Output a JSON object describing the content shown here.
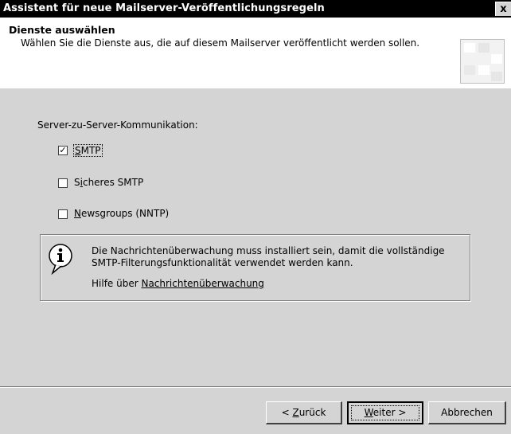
{
  "window": {
    "title": "Assistent für neue Mailserver-Veröffentlichungsregeln",
    "close": "x"
  },
  "header": {
    "title": "Dienste auswählen",
    "subtitle": "Wählen Sie die Dienste aus, die auf diesem Mailserver veröffentlicht werden sollen."
  },
  "section": {
    "label": "Server-zu-Server-Kommunikation:"
  },
  "options": [
    {
      "label": "SMTP",
      "checked": true
    },
    {
      "label": "Sicheres SMTP",
      "checked": false
    },
    {
      "label": "Newsgroups (NNTP)",
      "checked": false
    }
  ],
  "info": {
    "text": "Die Nachrichtenüberwachung muss installiert sein, damit die vollständige SMTP-Filterungsfunktionalität verwendet werden kann.",
    "help_prefix": "Hilfe über ",
    "help_link": "Nachrichtenüberwachung"
  },
  "buttons": {
    "back": "< Zurück",
    "next": "Weiter >",
    "cancel": "Abbrechen"
  }
}
